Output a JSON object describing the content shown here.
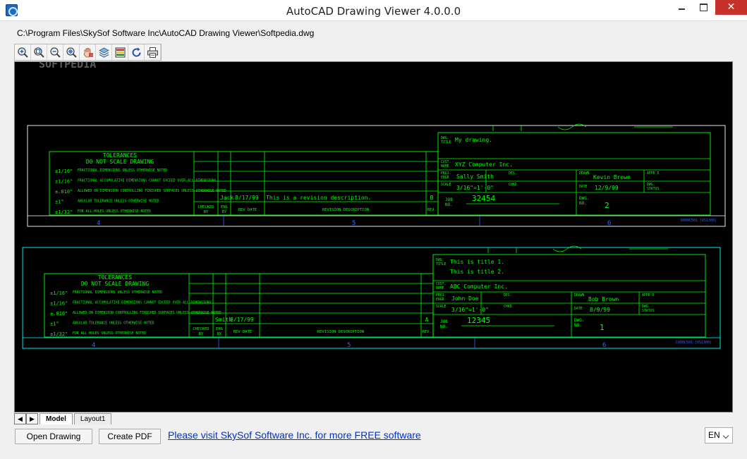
{
  "window": {
    "title": "AutoCAD Drawing Viewer 4.0.0.0",
    "close_glyph": "✕"
  },
  "file_path": "C:\\Program Files\\SkySof Software Inc\\AutoCAD Drawing Viewer\\Softpedia.dwg",
  "toolbar": {
    "icons": [
      "zoom-in-icon",
      "zoom-window-icon",
      "zoom-out-icon",
      "zoom-extents-icon",
      "pan-icon",
      "layers-icon",
      "colors-icon",
      "refresh-icon",
      "print-icon"
    ]
  },
  "drawing": {
    "watermark": "SOFTPEDIA",
    "colors": {
      "frame_top": "#ffffff",
      "frame_bottom": "#00ffff",
      "text": "#00ff00",
      "zone": "#3366ff"
    },
    "tolerances": {
      "title": "TOLERANCES",
      "subtitle": "DO NOT SCALE DRAWING",
      "rows": [
        {
          "value": "±1/16\"",
          "note": "FRACTIONAL DIMENSIONS UNLESS OTHERWISE NOTED"
        },
        {
          "value": "±1/16\"",
          "note": "FRACTIONAL ACCUMULATIVE DIMENSIONS CANNOT EXCEED OVER-ALL DIMENSIONS"
        },
        {
          "value": "±.010\"",
          "note": "ALLOWED ON DIMENSION CONTROLLING FINISHED SURFACES UNLESS OTHERWISE NOTED"
        },
        {
          "value": "±1°",
          "note": "ANGULAR TOLERANCE UNLESS OTHERWISE NOTED"
        },
        {
          "value": "±1/32\"",
          "note": "FOR ALL HOLES UNLESS OTHERWISE NOTED"
        }
      ]
    },
    "labels": {
      "checked_by": [
        "CHECKED",
        "BY"
      ],
      "eng_by": [
        "ENG",
        "BY"
      ],
      "rev_date": "REV DATE",
      "revision_description": "REVISION DESCRIPTION",
      "rev": "REV.",
      "dwg_title": [
        "DWG.",
        "TITLE"
      ],
      "cust_name": [
        "CUST.",
        "NAME"
      ],
      "proj_engr": [
        "PROJ.",
        "ENGR"
      ],
      "des": "DES.",
      "drawn": "DRAWN",
      "apprd": "APPR'D",
      "scale": "SCALE",
      "chkd": "CHKD.",
      "date": "DATE",
      "dwg_status": [
        "DWG.",
        "STATUS"
      ],
      "job_no": [
        "JOB",
        "NO."
      ],
      "dwg_no": [
        "DWG.",
        "NO."
      ]
    },
    "sheet_top": {
      "revision": {
        "checked": "Jack",
        "date": "8/17/99",
        "description": "This is a revision description.",
        "rev": "B"
      },
      "title_lines": [
        "My drawing."
      ],
      "customer": "XYZ Computer Inc.",
      "proj_engr": "Sally Smith",
      "drawn": "Kevin Brown",
      "scale": "3/16\"=1'-0\"",
      "date": "12/9/99",
      "job_no": "32454",
      "dwg_no": "2",
      "zones": [
        "4",
        "5",
        "6"
      ],
      "ref_code": "D000C501 (VS1300)"
    },
    "sheet_bottom": {
      "revision": {
        "checked": "Smith",
        "date": "8/17/99",
        "description": "",
        "rev": "A"
      },
      "title_lines": [
        "This is title 1.",
        "This is title 2."
      ],
      "customer": "ABC Computer Inc.",
      "proj_engr": "John Doe",
      "drawn": "Bob Brown",
      "scale": "3/16\"=1'-0\"",
      "date": "8/9/99",
      "job_no": "12345",
      "dwg_no": "1",
      "zones": [
        "4",
        "5",
        "6"
      ],
      "ref_code": "C000C501 (VS1300)"
    }
  },
  "tabs": {
    "prev_glyph": "◀",
    "next_glyph": "▶",
    "items": [
      {
        "label": "Model",
        "active": true
      },
      {
        "label": "Layout1",
        "active": false
      }
    ]
  },
  "buttons": {
    "open_drawing": "Open Drawing",
    "create_pdf": "Create PDF"
  },
  "link": {
    "text": "Please visit SkySof Software Inc. for more FREE software"
  },
  "language": {
    "selected": "EN"
  }
}
